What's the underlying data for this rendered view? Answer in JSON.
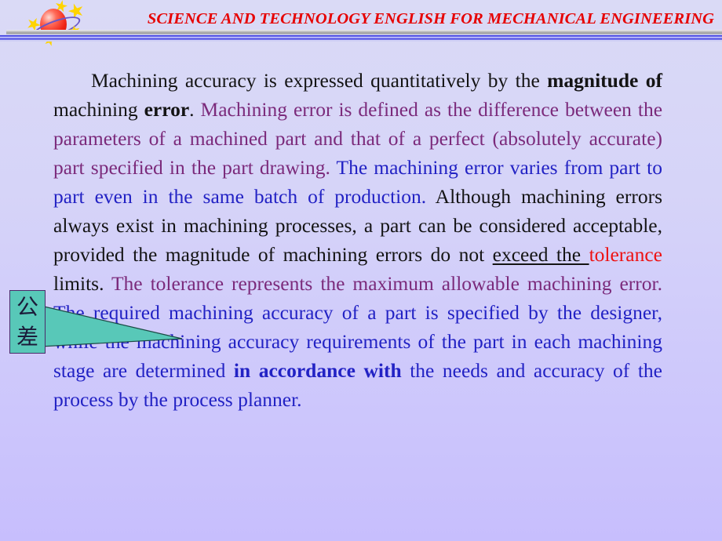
{
  "slide": {
    "header": {
      "title": "SCIENCE AND TECHNOLOGY ENGLISH FOR MECHANICAL ENGINEERING",
      "title_color": "#e60000",
      "logo_icon": "planet-with-stars-icon",
      "rule_gray_color": "#9a9a9a",
      "rule_blue_color": "#3a3ae0"
    },
    "background": {
      "gradient_top": "#dadaf6",
      "gradient_bottom": "#c7befd"
    },
    "body": {
      "segments": [
        {
          "text": "Machining accuracy is expressed quantitatively by the ",
          "color": "black",
          "bold": false,
          "underline": false
        },
        {
          "text": "magnitude of ",
          "color": "black",
          "bold": true,
          "underline": false
        },
        {
          "text": "machining ",
          "color": "black",
          "bold": false,
          "underline": false
        },
        {
          "text": "error",
          "color": "black",
          "bold": true,
          "underline": false
        },
        {
          "text": ". ",
          "color": "black",
          "bold": false,
          "underline": false
        },
        {
          "text": "Machining error is defined as the difference between the parameters of a machined part and that of a perfect (absolutely accurate) part specified in the part drawing. ",
          "color": "purple",
          "bold": false,
          "underline": false
        },
        {
          "text": "The machining error varies from part to part even in the same batch of production. ",
          "color": "blue",
          "bold": false,
          "underline": false
        },
        {
          "text": "Although machining errors always exist in machining processes, a part can be considered acceptable, provided the magnitude of machining errors do not ",
          "color": "black",
          "bold": false,
          "underline": false
        },
        {
          "text": "exceed the ",
          "color": "black",
          "bold": false,
          "underline": true
        },
        {
          "text": "tolerance",
          "color": "red",
          "bold": false,
          "underline": false
        },
        {
          "text": " limits. ",
          "color": "black",
          "bold": false,
          "underline": false
        },
        {
          "text": "The tolerance represents the maximum allowable machining error. ",
          "color": "purple",
          "bold": false,
          "underline": false
        },
        {
          "text": "The required machining accuracy of a part is specified by the designer, while the machining accuracy requirements of the part in each machining stage are determined ",
          "color": "blue",
          "bold": false,
          "underline": false
        },
        {
          "text": "in accordance with",
          "color": "blue",
          "bold": true,
          "underline": false
        },
        {
          "text": " the needs and accuracy of the process by the process planner.",
          "color": "blue",
          "bold": false,
          "underline": false
        }
      ],
      "colors": {
        "black": "#141414",
        "purple": "#7b2a7b",
        "blue": "#2222c4",
        "red": "#ee1111"
      }
    },
    "callout": {
      "label_char_1": "公",
      "label_char_2": "差",
      "fill_color": "#58c8b8",
      "border_color": "#4a2a6a",
      "points_to": "tolerance"
    }
  }
}
